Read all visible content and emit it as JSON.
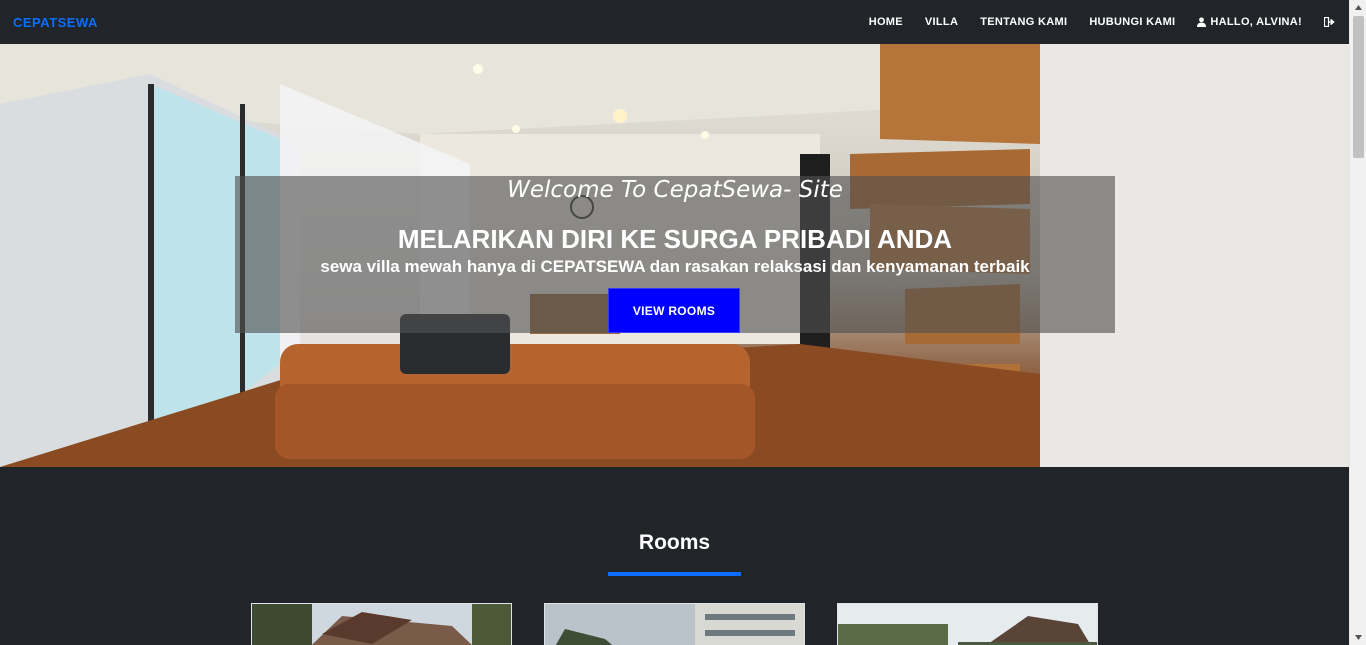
{
  "navbar": {
    "brand": "CEPATSEWA",
    "links": [
      {
        "label": "HOME"
      },
      {
        "label": "VILLA"
      },
      {
        "label": "TENTANG KAMI"
      },
      {
        "label": "HUBUNGI KAMI"
      }
    ],
    "user_greeting": "HALLO, ALVINA!"
  },
  "hero": {
    "welcome": "Welcome To CepatSewa- Site",
    "title": "MELARIKAN DIRI KE SURGA PRIBADI ANDA",
    "subtitle": "sewa villa mewah hanya di CEPATSEWA dan rasakan relaksasi dan kenyamanan terbaik",
    "button_label": "VIEW ROOMS"
  },
  "rooms": {
    "title": "Rooms"
  },
  "colors": {
    "background": "#212529",
    "brand": "#0d6efd",
    "button": "#0000ff"
  }
}
